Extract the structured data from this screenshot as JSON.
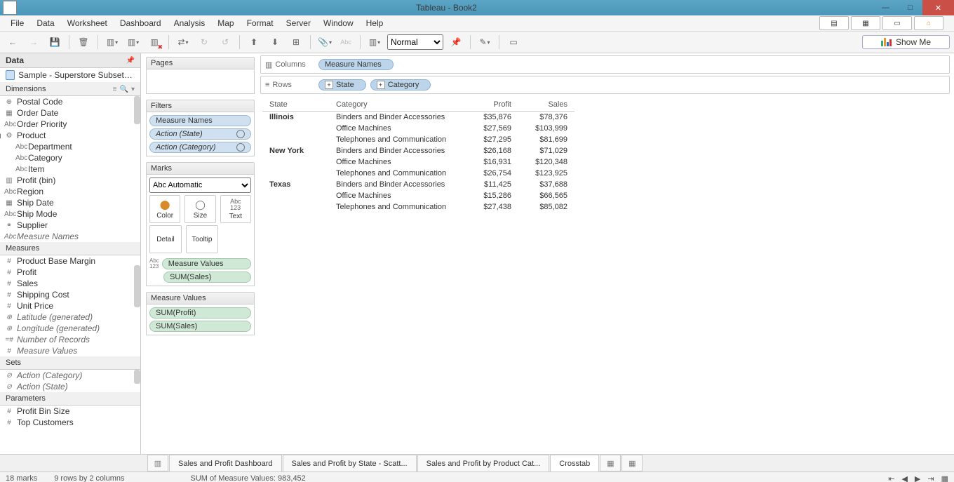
{
  "window": {
    "title": "Tableau - Book2"
  },
  "menu": [
    "File",
    "Data",
    "Worksheet",
    "Dashboard",
    "Analysis",
    "Map",
    "Format",
    "Server",
    "Window",
    "Help"
  ],
  "toolbar": {
    "fit": "Normal",
    "showme": "Show Me"
  },
  "data": {
    "header": "Data",
    "source": "Sample - Superstore Subset (E...)",
    "dimensions": "Dimensions",
    "dimFields": [
      {
        "ico": "⊕",
        "label": "Postal Code"
      },
      {
        "ico": "▦",
        "label": "Order Date"
      },
      {
        "ico": "Abc",
        "label": "Order Priority"
      },
      {
        "ico": "▸",
        "label": "Product",
        "prod": true
      },
      {
        "ico": "Abc",
        "label": "Department",
        "ind": true
      },
      {
        "ico": "Abc",
        "label": "Category",
        "ind": true
      },
      {
        "ico": "Abc",
        "label": "Item",
        "ind": true
      },
      {
        "ico": "▥",
        "label": "Profit (bin)"
      },
      {
        "ico": "Abc",
        "label": "Region"
      },
      {
        "ico": "▦",
        "label": "Ship Date"
      },
      {
        "ico": "Abc",
        "label": "Ship Mode"
      },
      {
        "ico": "⚭",
        "label": "Supplier"
      },
      {
        "ico": "Abc",
        "label": "Measure Names",
        "italic": true
      }
    ],
    "measures": "Measures",
    "measFields": [
      {
        "ico": "#",
        "label": "Product Base Margin"
      },
      {
        "ico": "#",
        "label": "Profit"
      },
      {
        "ico": "#",
        "label": "Sales"
      },
      {
        "ico": "#",
        "label": "Shipping Cost"
      },
      {
        "ico": "#",
        "label": "Unit Price"
      },
      {
        "ico": "⊕",
        "label": "Latitude (generated)",
        "italic": true
      },
      {
        "ico": "⊕",
        "label": "Longitude (generated)",
        "italic": true
      },
      {
        "ico": "=#",
        "label": "Number of Records",
        "italic": true
      },
      {
        "ico": "#",
        "label": "Measure Values",
        "italic": true
      }
    ],
    "sets": "Sets",
    "setFields": [
      {
        "ico": "⊘",
        "label": "Action (Category)",
        "italic": true
      },
      {
        "ico": "⊘",
        "label": "Action (State)",
        "italic": true
      }
    ],
    "parameters": "Parameters",
    "paramFields": [
      {
        "ico": "#",
        "label": "Profit Bin Size"
      },
      {
        "ico": "#",
        "label": "Top Customers"
      }
    ]
  },
  "cards": {
    "pages": "Pages",
    "filters": "Filters",
    "filterPills": [
      "Measure Names",
      "Action (State)",
      "Action (Category)"
    ],
    "marks": "Marks",
    "markType": "Automatic",
    "markAbc": "Abc",
    "markBtns": [
      [
        "●",
        "Color"
      ],
      [
        "○",
        "Size"
      ],
      [
        "Abc\n123",
        "Text"
      ],
      [
        "",
        "Detail"
      ],
      [
        "",
        "Tooltip"
      ]
    ],
    "markPills": [
      "Measure Values",
      "SUM(Sales)"
    ],
    "mv": "Measure Values",
    "mvPills": [
      "SUM(Profit)",
      "SUM(Sales)"
    ]
  },
  "shelves": {
    "columns": "Columns",
    "columnsPills": [
      "Measure Names"
    ],
    "rows": "Rows",
    "rowsPills": [
      "State",
      "Category"
    ]
  },
  "crosstab": {
    "headers": [
      "State",
      "Category",
      "Profit",
      "Sales"
    ],
    "rows": [
      {
        "state": "Illinois",
        "cat": "Binders and Binder Accessories",
        "profit": "$35,876",
        "sales": "$78,376"
      },
      {
        "state": "",
        "cat": "Office Machines",
        "profit": "$27,569",
        "sales": "$103,999"
      },
      {
        "state": "",
        "cat": "Telephones and Communication",
        "profit": "$27,295",
        "sales": "$81,699"
      },
      {
        "state": "New York",
        "cat": "Binders and Binder Accessories",
        "profit": "$26,168",
        "sales": "$71,029"
      },
      {
        "state": "",
        "cat": "Office Machines",
        "profit": "$16,931",
        "sales": "$120,348"
      },
      {
        "state": "",
        "cat": "Telephones and Communication",
        "profit": "$26,754",
        "sales": "$123,925"
      },
      {
        "state": "Texas",
        "cat": "Binders and Binder Accessories",
        "profit": "$11,425",
        "sales": "$37,688"
      },
      {
        "state": "",
        "cat": "Office Machines",
        "profit": "$15,286",
        "sales": "$66,565"
      },
      {
        "state": "",
        "cat": "Telephones and Communication",
        "profit": "$27,438",
        "sales": "$85,082"
      }
    ]
  },
  "tabs": [
    "Sales and Profit Dashboard",
    "Sales and Profit by State - Scatt...",
    "Sales and Profit by Product Cat...",
    "Crosstab"
  ],
  "status": {
    "a": "18 marks",
    "b": "9 rows by 2 columns",
    "c": "SUM of Measure Values: 983,452"
  }
}
